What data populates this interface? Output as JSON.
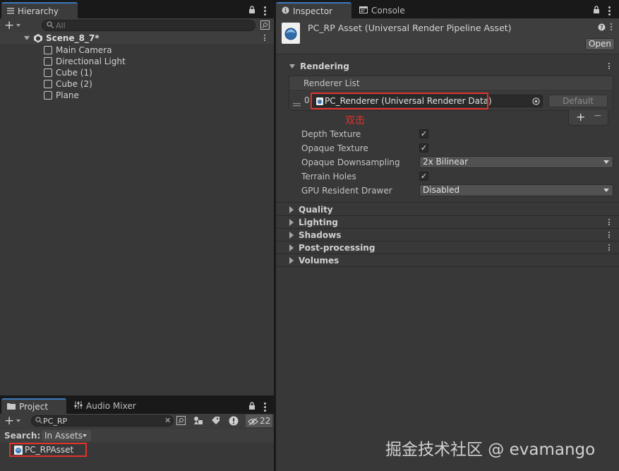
{
  "hierarchy": {
    "tab_label": "Hierarchy",
    "search_placeholder": "All",
    "scene_name": "Scene_8_7*",
    "items": [
      "Main Camera",
      "Directional Light",
      "Cube (1)",
      "Cube (2)",
      "Plane"
    ]
  },
  "project": {
    "tab_project": "Project",
    "tab_audio_mixer": "Audio Mixer",
    "search_value": "PC_RP",
    "search_label": "Search:",
    "scope": "In Assets",
    "hidden_count": "22",
    "result_item": "PC_RPAsset"
  },
  "inspector": {
    "tab_inspector": "Inspector",
    "tab_console": "Console",
    "asset_title": "PC_RP Asset (Universal Render Pipeline Asset)",
    "open_button": "Open",
    "rendering_section": "Rendering",
    "renderer_list_label": "Renderer List",
    "renderer_index": "0",
    "renderer_value": "PC_Renderer (Universal Renderer Data)",
    "default_button": "Default",
    "add_button": "+",
    "remove_button": "−",
    "annotation": "双击",
    "properties": {
      "depth_texture": "Depth Texture",
      "opaque_texture": "Opaque Texture",
      "opaque_downsampling": "Opaque Downsampling",
      "opaque_downsampling_value": "2x Bilinear",
      "terrain_holes": "Terrain Holes",
      "gpu_resident_drawer": "GPU Resident Drawer",
      "gpu_resident_drawer_value": "Disabled"
    },
    "sections": [
      "Quality",
      "Lighting",
      "Shadows",
      "Post-processing",
      "Volumes"
    ]
  },
  "watermark": "掘金技术社区 @ evamango",
  "colors": {
    "accent": "#3a79bb",
    "annotation_red": "#e0332c",
    "panel": "#383838"
  }
}
